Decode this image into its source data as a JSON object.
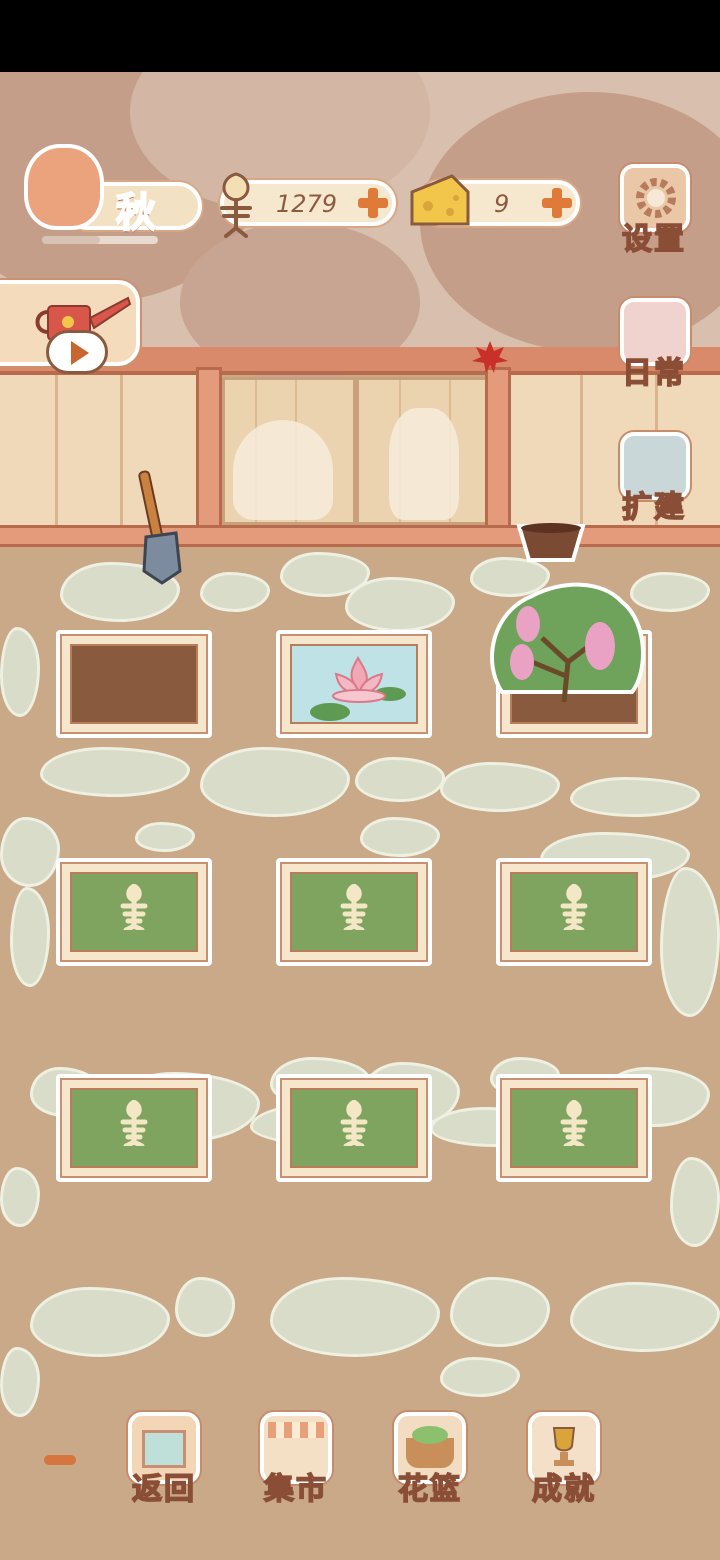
{
  "season": {
    "label": "秋",
    "progress": 0.5
  },
  "currencies": {
    "fishbone": {
      "icon": "fishbone-icon",
      "value": "1279"
    },
    "cheese": {
      "icon": "cheese-icon",
      "value": "9"
    }
  },
  "side_menu": {
    "settings": {
      "label": "设置",
      "icon": "gear-icon"
    },
    "daily": {
      "label": "日常",
      "icon": "tip-note-icon"
    },
    "expand": {
      "label": "扩建",
      "icon": "hammer-paint-icon"
    }
  },
  "watering": {
    "icon": "watering-can-icon",
    "action": "play-icon"
  },
  "tools": {
    "shovel": "shovel-icon",
    "pot": "flower-pot-icon"
  },
  "plots": [
    {
      "state": "empty-soil"
    },
    {
      "state": "water-lily"
    },
    {
      "state": "flowering-bush"
    },
    {
      "state": "locked-grass",
      "icon": "fishbone-icon"
    },
    {
      "state": "locked-grass",
      "icon": "fishbone-icon"
    },
    {
      "state": "locked-grass",
      "icon": "fishbone-icon"
    },
    {
      "state": "locked-grass",
      "icon": "fishbone-icon"
    },
    {
      "state": "locked-grass",
      "icon": "fishbone-icon"
    },
    {
      "state": "locked-grass",
      "icon": "fishbone-icon"
    }
  ],
  "bottom_nav": {
    "back": {
      "label": "返回",
      "icon": "window-icon"
    },
    "market": {
      "label": "集市",
      "icon": "market-stall-icon"
    },
    "basket": {
      "label": "花篮",
      "icon": "flower-basket-icon"
    },
    "achievements": {
      "label": "成就",
      "icon": "trophy-icon"
    }
  },
  "colors": {
    "accent": "#e07a38",
    "label_fill": "#e9b692",
    "label_stroke": "#8a4d35",
    "grass": "#7ea45f",
    "soil": "#8a5a3e"
  }
}
